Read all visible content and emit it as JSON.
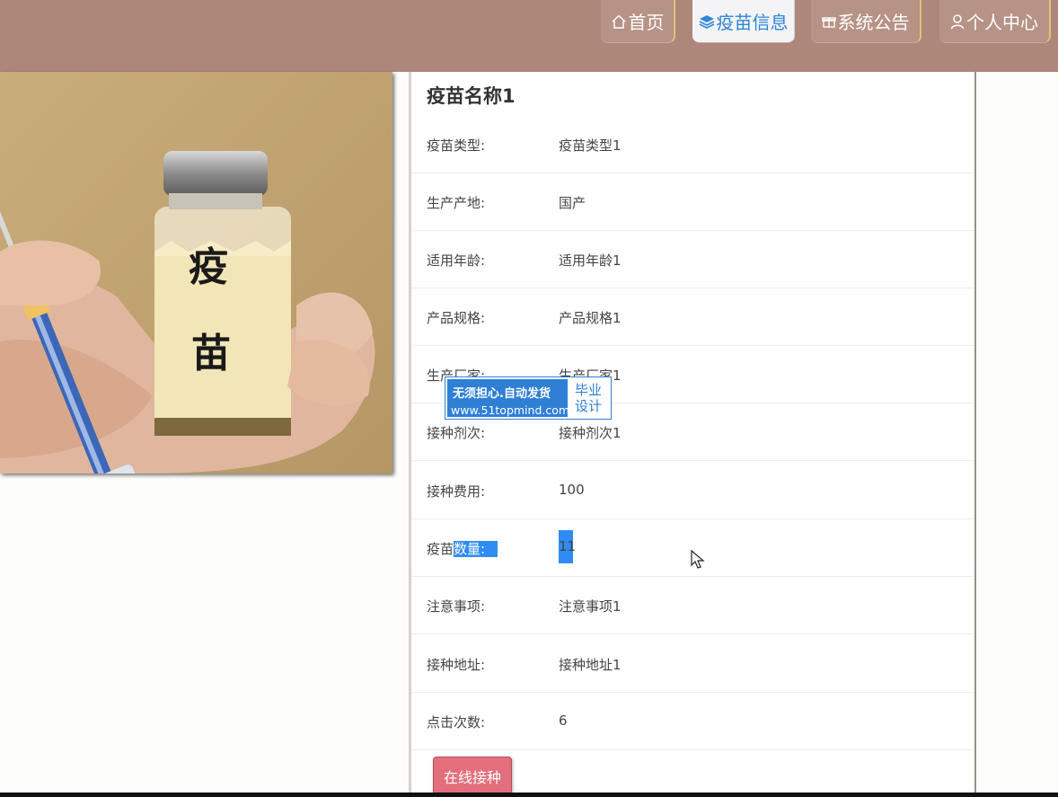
{
  "nav": {
    "items": [
      {
        "label": "首页",
        "icon": "home-icon",
        "active": false
      },
      {
        "label": "疫苗信息",
        "icon": "layers-icon",
        "active": true
      },
      {
        "label": "系统公告",
        "icon": "gift-icon",
        "active": false
      },
      {
        "label": "个人中心",
        "icon": "user-icon",
        "active": false
      }
    ]
  },
  "photo": {
    "icon": "vaccine-photo",
    "vial_text_1": "疫",
    "vial_text_2": "苗"
  },
  "detail": {
    "title": "疫苗名称1",
    "rows": [
      {
        "label": "疫苗类型:",
        "value": "疫苗类型1"
      },
      {
        "label": "生产产地:",
        "value": "国产"
      },
      {
        "label": "适用年龄:",
        "value": "适用年龄1"
      },
      {
        "label": "产品规格:",
        "value": "产品规格1"
      },
      {
        "label": "生产厂家:",
        "value": "生产厂家1"
      },
      {
        "label": "接种剂次:",
        "value": "接种剂次1"
      },
      {
        "label": "接种费用:",
        "value": "100"
      },
      {
        "label_prefix": "疫苗",
        "label_selected": "数量:",
        "value": "11"
      },
      {
        "label": "注意事项:",
        "value": "注意事项1"
      },
      {
        "label": "接种地址:",
        "value": "接种地址1"
      },
      {
        "label": "点击次数:",
        "value": "6"
      }
    ],
    "apply_label": "在线接种"
  },
  "watermark": {
    "line1": "无须担心.自动发货",
    "line2": "www.51topmind.com",
    "box_line1": "毕业",
    "box_line2": "设计"
  },
  "colors": {
    "topbar": "#ae877b",
    "active_nav_text": "#2d86d8",
    "apply_button": "#e36f7d",
    "selection": "#2f8cf4"
  }
}
